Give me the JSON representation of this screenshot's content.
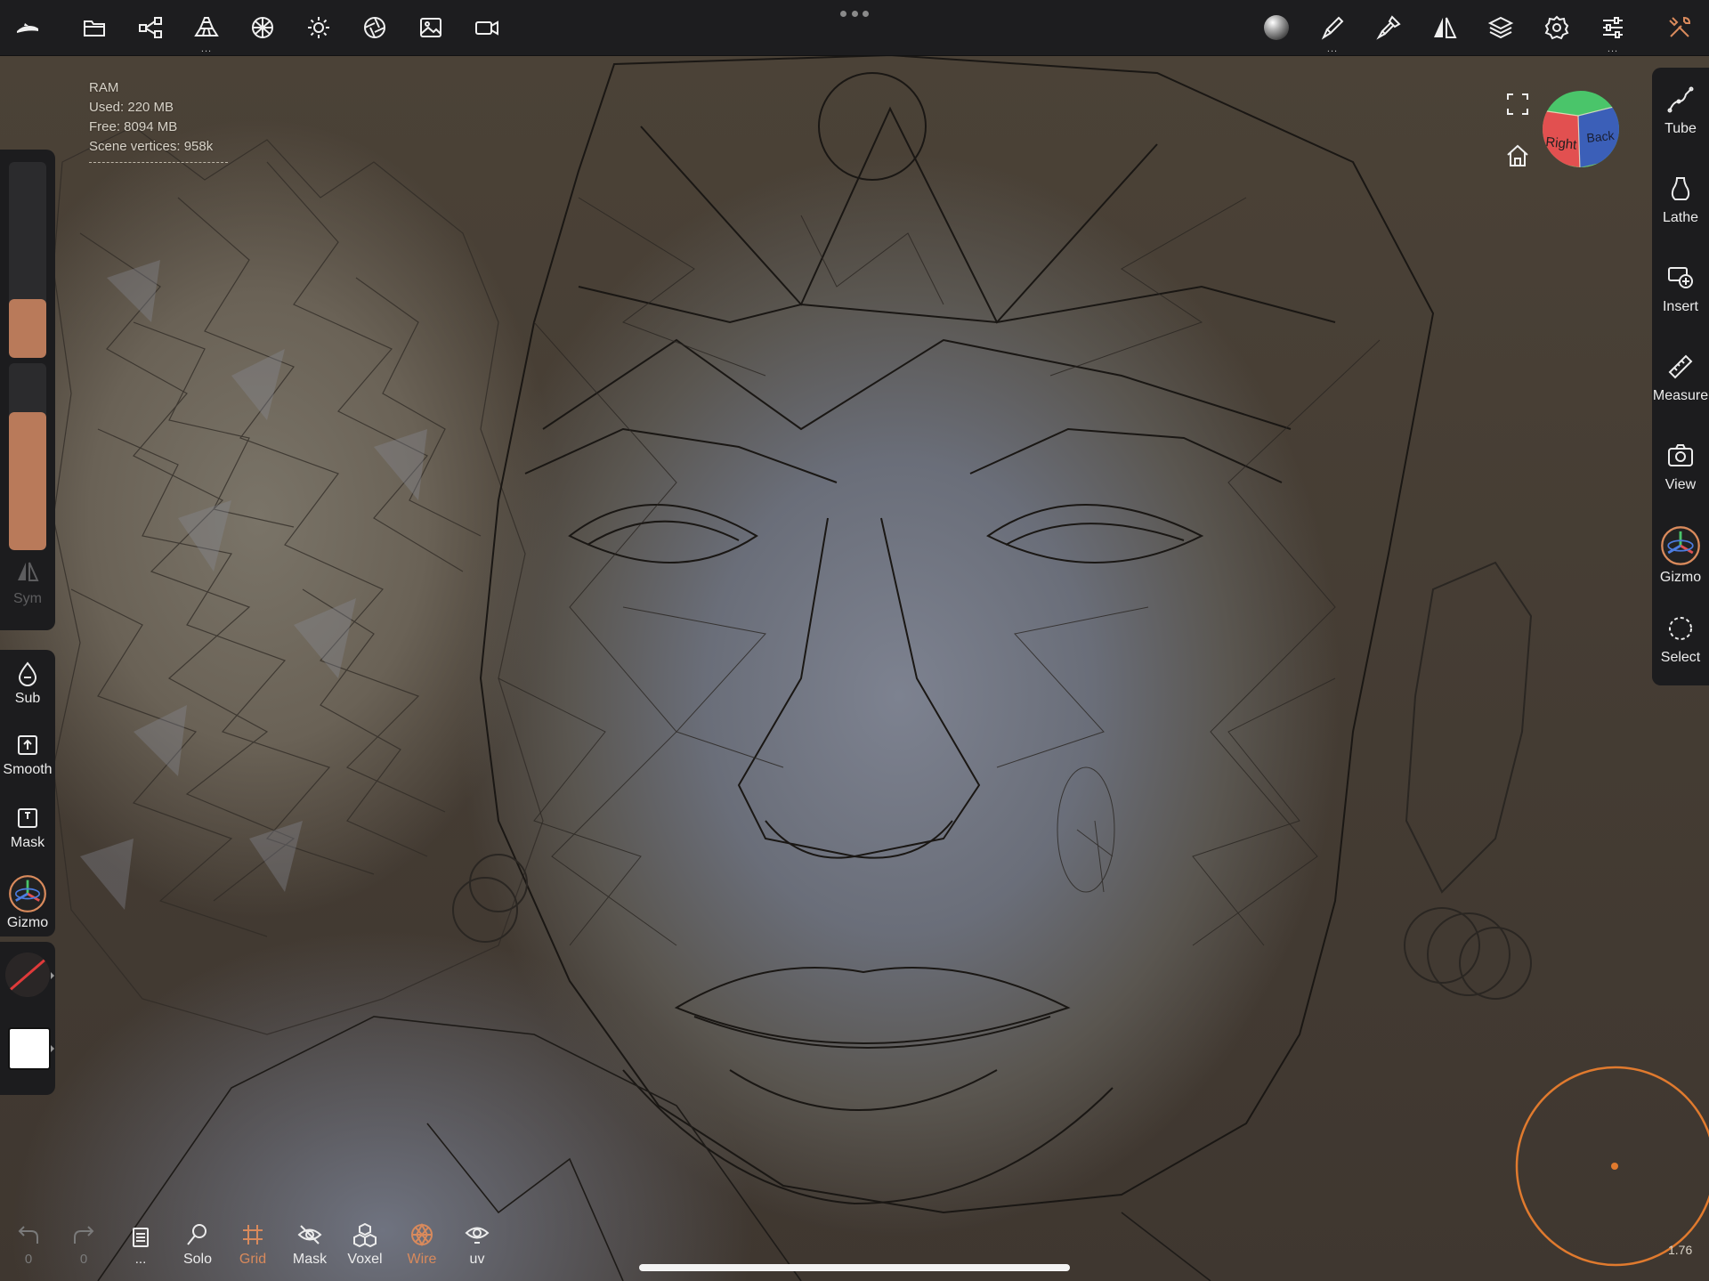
{
  "app": {
    "accent_color": "#d98a5c",
    "panel_color": "#1c1c1e"
  },
  "topbar": {
    "left_buttons": [
      {
        "icon": "app-logo-icon"
      },
      {
        "icon": "folder-icon"
      },
      {
        "icon": "scene-graph-icon"
      },
      {
        "icon": "voxel-blocks-icon",
        "more": "..."
      },
      {
        "icon": "material-sphere-grid-icon"
      },
      {
        "icon": "sun-light-icon"
      },
      {
        "icon": "camera-aperture-icon"
      },
      {
        "icon": "image-icon"
      },
      {
        "icon": "video-camera-icon"
      }
    ],
    "right_buttons": [
      {
        "icon": "matcap-sphere-icon"
      },
      {
        "icon": "brush-icon",
        "more": "..."
      },
      {
        "icon": "painter-tool-icon"
      },
      {
        "icon": "symmetry-icon"
      },
      {
        "icon": "layers-icon"
      },
      {
        "icon": "settings-gear-icon"
      },
      {
        "icon": "sliders-icon",
        "more": "..."
      },
      {
        "icon": "tools-wrench-icon"
      }
    ]
  },
  "stats": {
    "ram_label": "RAM",
    "used": "Used: 220 MB",
    "free": "Free: 8094 MB",
    "scene_vertices": "Scene vertices: 958k"
  },
  "left_panel": {
    "radius_slider_level": 0.3,
    "intensity_slider_level": 0.74,
    "sym_label": "Sym",
    "tools": [
      {
        "label": "Sub",
        "icon": "drop-icon"
      },
      {
        "label": "Smooth",
        "icon": "smooth-icon"
      },
      {
        "label": "Mask",
        "icon": "mask-icon"
      },
      {
        "label": "Gizmo",
        "icon": "gizmo-icon"
      }
    ]
  },
  "right_panel": {
    "tools": [
      {
        "label": "Tube",
        "icon": "tube-curve-icon"
      },
      {
        "label": "Lathe",
        "icon": "lathe-vase-icon"
      },
      {
        "label": "Insert",
        "icon": "insert-shape-icon"
      },
      {
        "label": "Measure",
        "icon": "ruler-icon"
      },
      {
        "label": "View",
        "icon": "camera-icon"
      },
      {
        "label": "Gizmo",
        "icon": "gizmo-icon"
      },
      {
        "label": "Select",
        "icon": "select-lasso-icon"
      }
    ]
  },
  "view_cube": {
    "faces": {
      "right": "Right",
      "back": "Back"
    },
    "colors": {
      "top": "#4ac56a",
      "right": "#e25050",
      "back": "#3b5fb8"
    }
  },
  "bottombar": {
    "undo": {
      "count": "0",
      "icon": "undo-icon"
    },
    "redo": {
      "count": "0",
      "icon": "redo-icon"
    },
    "history": {
      "more": "...",
      "icon": "history-book-icon"
    },
    "buttons": [
      {
        "label": "Solo",
        "icon": "solo-search-icon",
        "active": false
      },
      {
        "label": "Grid",
        "icon": "grid-icon",
        "active": true
      },
      {
        "label": "Mask",
        "icon": "mask-eye-icon",
        "active": false
      },
      {
        "label": "Voxel",
        "icon": "voxel-cubes-icon",
        "active": false
      },
      {
        "label": "Wire",
        "icon": "wireframe-icon",
        "active": true
      },
      {
        "label": "uv",
        "icon": "uv-eye-icon",
        "active": false
      }
    ]
  },
  "brush": {
    "cursor_color": "#e07a2e",
    "zoom_readout": "1.76"
  }
}
